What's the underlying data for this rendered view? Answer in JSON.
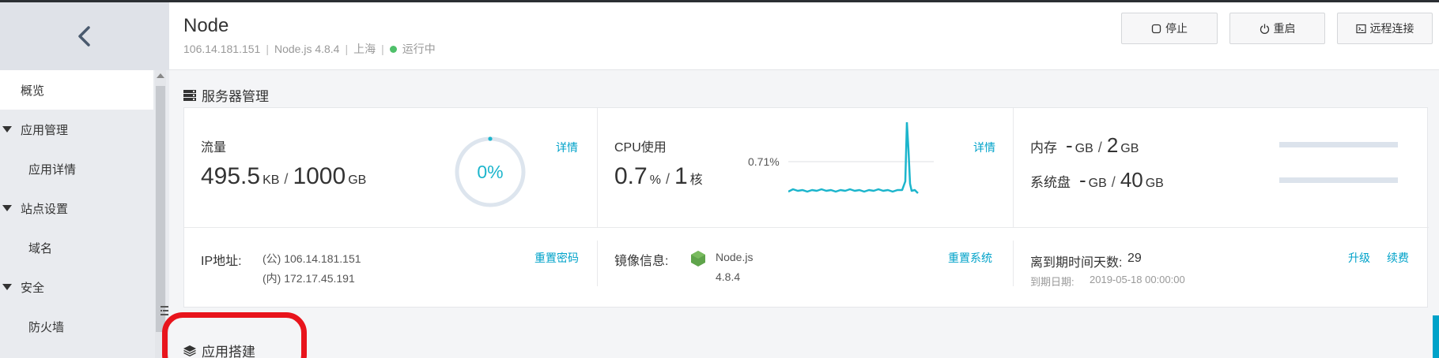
{
  "sidebar": {
    "items": [
      {
        "label": "概览",
        "kind": "top",
        "active": true
      },
      {
        "label": "应用管理",
        "kind": "group"
      },
      {
        "label": "应用详情",
        "kind": "sub"
      },
      {
        "label": "站点设置",
        "kind": "group"
      },
      {
        "label": "域名",
        "kind": "sub"
      },
      {
        "label": "安全",
        "kind": "group"
      },
      {
        "label": "防火墙",
        "kind": "sub"
      }
    ]
  },
  "header": {
    "title": "Node",
    "ip": "106.14.181.151",
    "runtime": "Node.js 4.8.4",
    "region": "上海",
    "status": "运行中",
    "status_color": "#4fc06a",
    "buttons": {
      "stop": "停止",
      "restart": "重启",
      "remote": "远程连接"
    }
  },
  "server": {
    "title": "服务器管理",
    "traffic": {
      "label": "流量",
      "used": "495.5",
      "used_unit": "KB",
      "total": "1000",
      "total_unit": "GB",
      "percent": "0%",
      "percent_value": 0.0,
      "link": "详情"
    },
    "cpu": {
      "label": "CPU使用",
      "value": "0.7",
      "unit": "%",
      "cores": "1",
      "cores_unit": "核",
      "peak_label": "0.71%",
      "link": "详情"
    },
    "memory": {
      "label": "内存",
      "used": "-",
      "used_unit": "GB",
      "total": "2",
      "total_unit": "GB"
    },
    "disk": {
      "label": "系统盘",
      "used": "-",
      "used_unit": "GB",
      "total": "40",
      "total_unit": "GB"
    },
    "ip": {
      "label": "IP地址:",
      "public": "(公) 106.14.181.151",
      "private": "(内) 172.17.45.191",
      "link": "重置密码"
    },
    "image": {
      "label": "镜像信息:",
      "name": "Node.js",
      "version": "4.8.4",
      "link": "重置系统"
    },
    "expiry": {
      "label": "离到期时间天数:",
      "days": "29",
      "date_label": "到期日期:",
      "date": "2019-05-18 00:00:00",
      "upgrade": "升级",
      "renew": "续费"
    }
  },
  "app": {
    "title": "应用搭建"
  },
  "colors": {
    "accent": "#00a2c9",
    "cpu_line": "#1cb5cc"
  }
}
